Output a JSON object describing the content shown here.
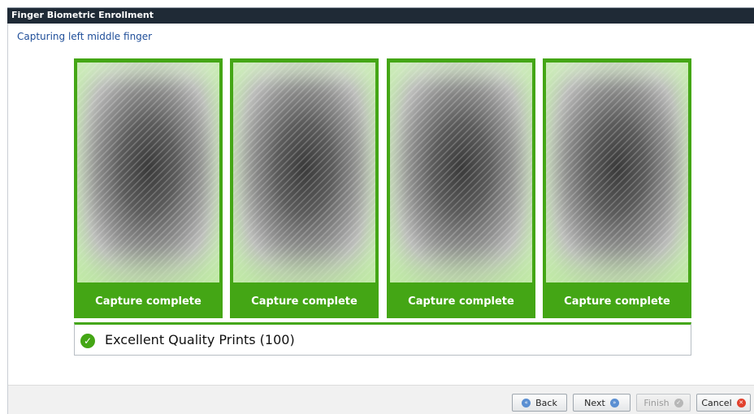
{
  "window": {
    "title": "Finger Biometric Enrollment"
  },
  "header": {
    "subtitle": "Capturing left middle finger"
  },
  "captures": [
    {
      "caption": "Capture complete"
    },
    {
      "caption": "Capture complete"
    },
    {
      "caption": "Capture complete"
    },
    {
      "caption": "Capture complete"
    }
  ],
  "quality": {
    "text": "Excellent Quality Prints (100)",
    "icon": "check-circle-icon"
  },
  "buttons": {
    "back": {
      "label": "Back",
      "icon": "rewind-icon"
    },
    "next": {
      "label": "Next",
      "icon": "fast-forward-icon"
    },
    "finish": {
      "label": "Finish",
      "icon": "check-icon"
    },
    "cancel": {
      "label": "Cancel",
      "icon": "close-icon"
    }
  },
  "colors": {
    "accent_green": "#44a615",
    "title_bar": "#1f2a36",
    "subtitle_blue": "#1f4e99"
  }
}
